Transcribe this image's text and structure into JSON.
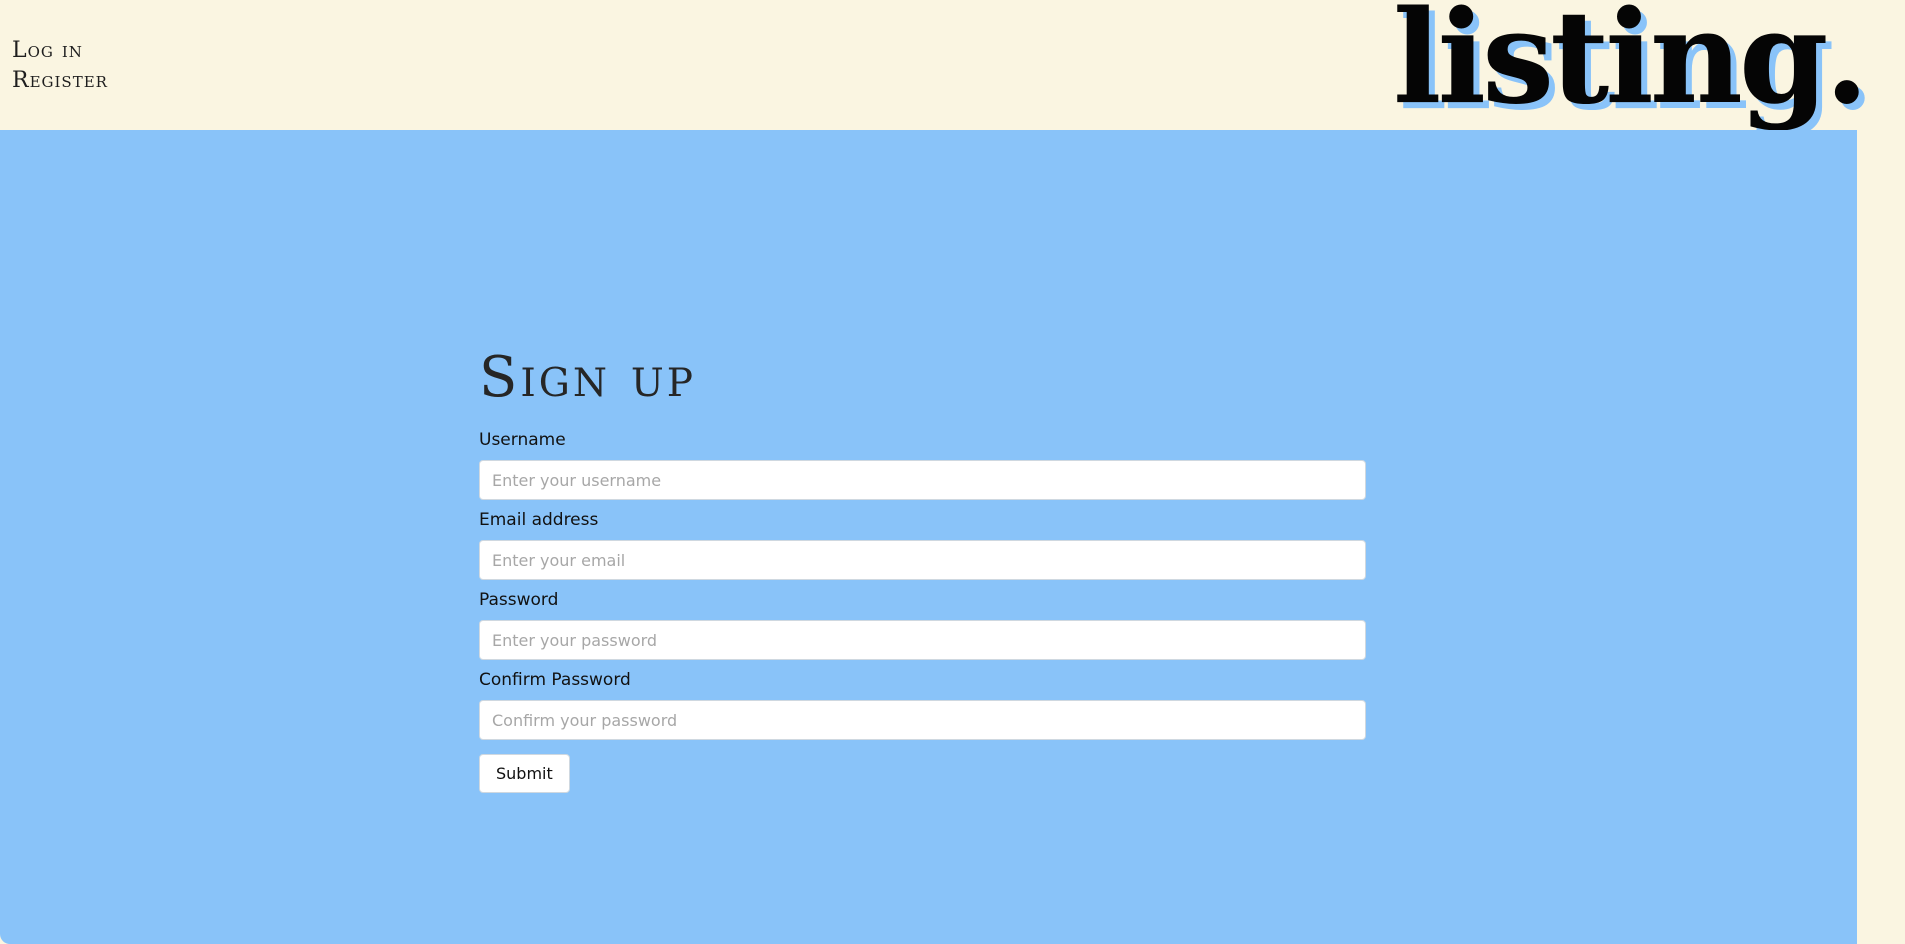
{
  "nav": {
    "login": "Log in",
    "register": "Register"
  },
  "brand": {
    "logo": "listing."
  },
  "form": {
    "title": "Sign up",
    "fields": [
      {
        "label": "Username",
        "placeholder": "Enter your username",
        "value": ""
      },
      {
        "label": "Email address",
        "placeholder": "Enter your email",
        "value": ""
      },
      {
        "label": "Password",
        "placeholder": "Enter your password",
        "value": ""
      },
      {
        "label": "Confirm Password",
        "placeholder": "Confirm your password",
        "value": ""
      }
    ],
    "submit_label": "Submit"
  },
  "colors": {
    "header_bg": "#faf5e1",
    "main_bg": "#89c3f9",
    "logo_shadow": "#89c3f9"
  }
}
